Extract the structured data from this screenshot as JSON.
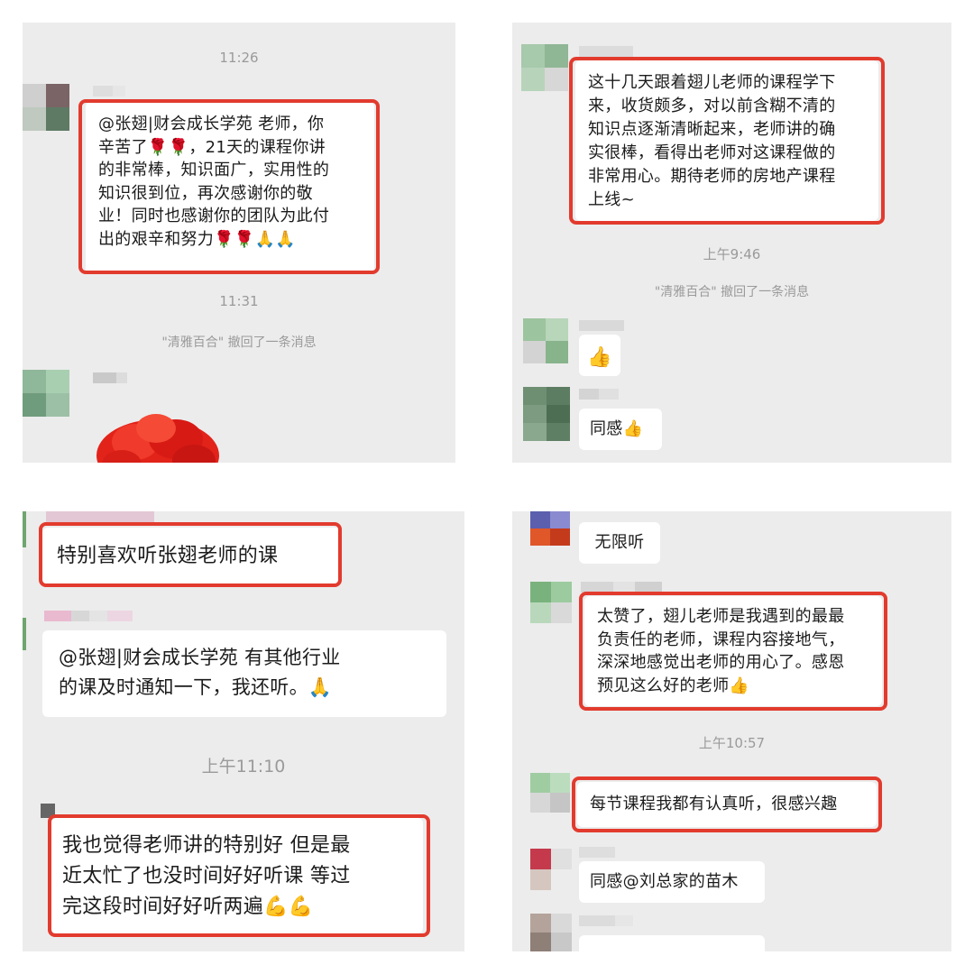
{
  "panel1": {
    "time_1": "11:26",
    "msg_1": "@张翅|财会成长学苑 老师，你\n辛苦了🌹🌹，21天的课程你讲\n的非常棒，知识面广，实用性的\n知识很到位，再次感谢你的敬\n业！同时也感谢你的团队为此付\n出的艰辛和努力🌹🌹🙏🙏",
    "time_2": "11:31",
    "recall_notice": "\"清雅百合\" 撤回了一条消息"
  },
  "panel2": {
    "msg_1": "这十几天跟着翅儿老师的课程学下\n来，收货颇多，对以前含糊不清的\n知识点逐渐清晰起来，老师讲的确\n实很棒，看得出老师对这课程做的\n非常用心。期待老师的房地产课程\n上线~",
    "time_1": "上午9:46",
    "recall_notice": "\"清雅百合\" 撤回了一条消息",
    "msg_2": "👍",
    "msg_3": "同感👍"
  },
  "panel3": {
    "msg_1": "特别喜欢听张翅老师的课",
    "msg_2": "@张翅|财会成长学苑 有其他行业\n的课及时通知一下，我还听。🙏",
    "time_1": "上午11:10",
    "msg_3": "我也觉得老师讲的特别好   但是最\n近太忙了也没时间好好听课   等过\n完这段时间好好听两遍💪💪"
  },
  "panel4": {
    "msg_1": "无限听",
    "msg_2": "太赞了，翅儿老师是我遇到的最最\n负责任的老师，课程内容接地气，\n深深地感觉出老师的用心了。感恩\n预见这么好的老师👍",
    "time_1": "上午10:57",
    "msg_3": "每节课程我都有认真听，很感兴趣",
    "msg_4": "同感@刘总家的苗木"
  },
  "colors": {
    "highlight_border": "#e23b2e",
    "chat_background": "#ececec",
    "bubble": "#ffffff"
  }
}
